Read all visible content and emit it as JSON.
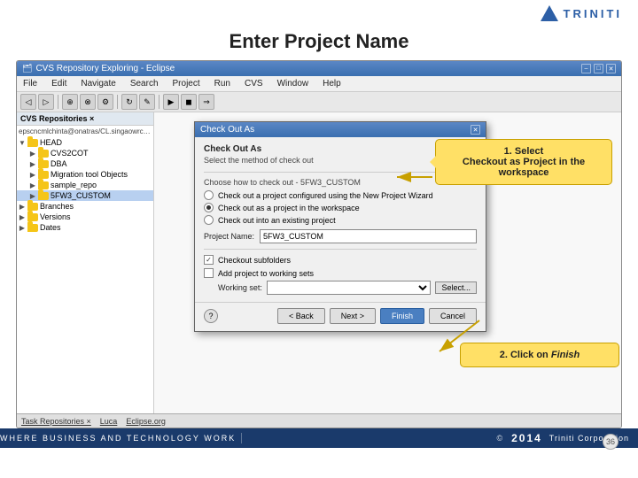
{
  "logo": {
    "text": "TRINITI"
  },
  "page": {
    "title": "Enter Project Name"
  },
  "eclipse": {
    "title": "CVS Repository Exploring - Eclipse",
    "menu": [
      "File",
      "Edit",
      "Navigate",
      "Search",
      "Project",
      "Run",
      "CVS",
      "Window",
      "Help"
    ],
    "left_panel_title": "CVS Repositories ×",
    "repo_url": "epscncmlchinta@onatras/CL.singaowrcorp.com/cvs",
    "tree_items": [
      {
        "label": "HEAD",
        "level": 1,
        "expanded": true
      },
      {
        "label": "CVS2COT",
        "level": 2
      },
      {
        "label": "DBA",
        "level": 2
      },
      {
        "label": "Migration tool Objects",
        "level": 2
      },
      {
        "label": "sample_repo",
        "level": 2
      },
      {
        "label": "5FW3_CUSTOM",
        "level": 2,
        "selected": true
      },
      {
        "label": "Branches",
        "level": 1
      },
      {
        "label": "Versions",
        "level": 1
      },
      {
        "label": "Dates",
        "level": 1
      }
    ]
  },
  "dialog": {
    "title": "Check Out As",
    "section_title": "Check Out As",
    "subtitle": "Select the method of check out",
    "separator_text": "Choose how to check out - 5FW3_CUSTOM",
    "radio_options": [
      {
        "label": "Check out a project configured using the New Project Wizard",
        "selected": false
      },
      {
        "label": "Check out as a project in the workspace",
        "selected": true
      },
      {
        "label": "Check out into an existing project",
        "selected": false
      }
    ],
    "project_name_label": "Project Name:",
    "project_name_value": "5FW3_CUSTOM",
    "checkout_subfolders_label": "Checkout subfolders",
    "checkout_subfolders_checked": true,
    "add_to_working_sets_label": "Add project to working sets",
    "add_to_working_sets_checked": false,
    "working_set_label": "Working set:",
    "select_btn_label": "Select...",
    "buttons": {
      "help": "?",
      "back": "< Back",
      "next": "Next >",
      "finish": "Finish",
      "cancel": "Cancel"
    }
  },
  "callouts": {
    "callout1": {
      "step": "1. Select",
      "text": "Checkout as Project in the workspace"
    },
    "callout2": {
      "step": "2. Click on",
      "finish_word": "Finish"
    }
  },
  "status_bar_items": [
    "Task Repositories ×",
    "Luca",
    "Eclipse.org"
  ],
  "footer": {
    "tagline": "WHERE BUSINESS AND TECHNOLOGY WORK",
    "copyright": "©",
    "year": "2014",
    "company": "Triniti Corporation"
  },
  "page_number": "36"
}
